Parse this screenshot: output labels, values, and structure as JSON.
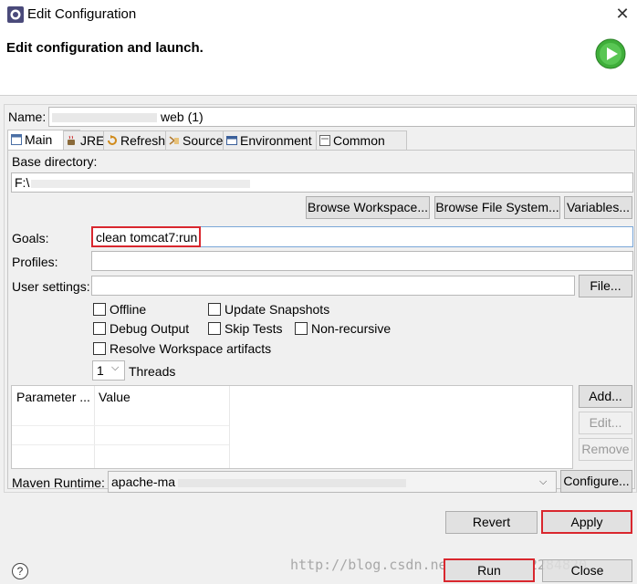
{
  "window": {
    "title": "Edit Configuration"
  },
  "header": {
    "title": "Edit configuration and launch."
  },
  "name": {
    "label": "Name:",
    "value": "web (1)"
  },
  "tabs": [
    {
      "label": "Main",
      "icon": "main-tab-icon"
    },
    {
      "label": "JRE",
      "icon": "jre-icon"
    },
    {
      "label": "Refresh",
      "icon": "refresh-icon"
    },
    {
      "label": "Source",
      "icon": "source-icon"
    },
    {
      "label": "Environment",
      "icon": "environment-icon"
    },
    {
      "label": "Common",
      "icon": "common-icon"
    }
  ],
  "main": {
    "base_directory_label": "Base directory:",
    "base_directory_value": "F:\\",
    "browse_workspace": "Browse Workspace...",
    "browse_file_system": "Browse File System...",
    "variables": "Variables...",
    "goals_label": "Goals:",
    "goals_value": "clean tomcat7:run",
    "profiles_label": "Profiles:",
    "profiles_value": "",
    "user_settings_label": "User settings:",
    "user_settings_value": "",
    "file_button": "File...",
    "checkboxes": {
      "offline": "Offline",
      "update_snapshots": "Update Snapshots",
      "debug_output": "Debug Output",
      "skip_tests": "Skip Tests",
      "non_recursive": "Non-recursive",
      "resolve_workspace": "Resolve Workspace artifacts"
    },
    "threads_value": "1",
    "threads_label": "Threads",
    "table": {
      "col_parameter": "Parameter ...",
      "col_value": "Value"
    },
    "add_button": "Add...",
    "edit_button": "Edit...",
    "remove_button": "Remove",
    "maven_runtime_label": "Maven Runtime:",
    "maven_runtime_value": "apache-ma",
    "configure_button": "Configure..."
  },
  "actions": {
    "revert": "Revert",
    "apply": "Apply",
    "run": "Run",
    "close": "Close"
  },
  "help": {
    "glyph": "?"
  },
  "watermark": "http://blog.csdn.net/LANYASY52284820",
  "colors": {
    "highlight": "#d9272e",
    "run_icon": "#3fae3a"
  }
}
